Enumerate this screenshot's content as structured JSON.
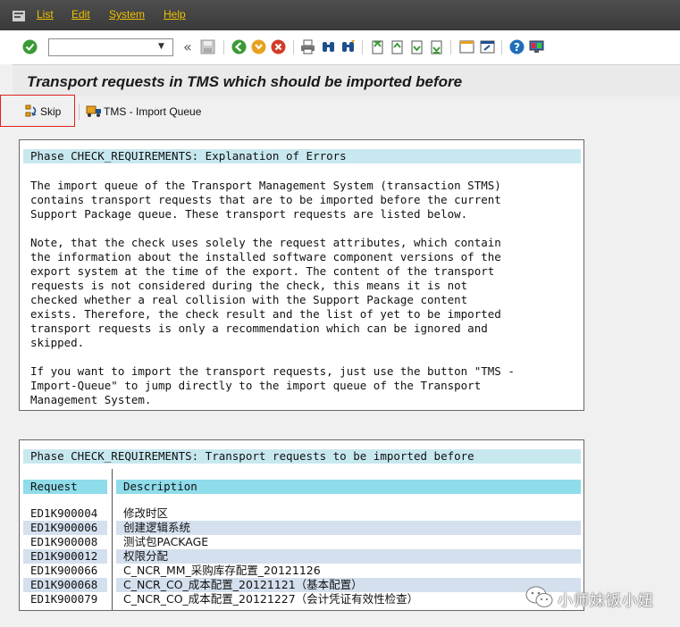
{
  "menubar": {
    "items": [
      {
        "label": "List"
      },
      {
        "label": "Edit"
      },
      {
        "label": "System"
      },
      {
        "label": "Help"
      }
    ]
  },
  "toolbar": {
    "command_field_value": "",
    "icons": [
      "enter-icon",
      "back-icon",
      "save-icon",
      "back-green-icon",
      "exit-icon",
      "cancel-icon",
      "print-icon",
      "find-icon",
      "find-next-icon",
      "first-page-icon",
      "prev-page-icon",
      "next-page-icon",
      "last-page-icon",
      "create-session-icon",
      "shortcut-icon",
      "help-icon",
      "customize-layout-icon"
    ]
  },
  "title": "Transport requests in TMS which should be imported before",
  "app_toolbar": {
    "skip_label": "Skip",
    "tms_label": "TMS - Import Queue"
  },
  "panel1": {
    "heading": "Phase CHECK_REQUIREMENTS: Explanation of Errors",
    "body": "The import queue of the Transport Management System (transaction STMS)\ncontains transport requests that are to be imported before the current\nSupport Package queue. These transport requests are listed below.\n\nNote, that the check uses solely the request attributes, which contain\nthe information about the installed software component versions of the\nexport system at the time of the export. The content of the transport\nrequests is not considered during the check, this means it is not\nchecked whether a real collision with the Support Package content\nexists. Therefore, the check result and the list of yet to be imported\ntransport requests is only a recommendation which can be ignored and\nskipped.\n\nIf you want to import the transport requests, just use the button \"TMS -\nImport-Queue\" to jump directly to the import queue of the Transport\nManagement System."
  },
  "panel2": {
    "heading": "Phase CHECK_REQUIREMENTS: Transport requests to be imported before",
    "columns": {
      "request": "Request",
      "description": "Description"
    },
    "rows": [
      {
        "request": "ED1K900004",
        "description": "修改时区"
      },
      {
        "request": "ED1K900006",
        "description": "创建逻辑系统"
      },
      {
        "request": "ED1K900008",
        "description": "测试包PACKAGE"
      },
      {
        "request": "ED1K900012",
        "description": "权限分配"
      },
      {
        "request": "ED1K900066",
        "description": "C_NCR_MM_采购库存配置_20121126"
      },
      {
        "request": "ED1K900068",
        "description": "C_NCR_CO_成本配置_20121121（基本配置）"
      },
      {
        "request": "ED1K900079",
        "description": "C_NCR_CO_成本配置_20121227（会计凭证有效性检查）"
      }
    ]
  },
  "watermark": {
    "text": "小师妹饭小妞"
  },
  "colors": {
    "menubar": "#3a3a3a",
    "menu_text": "#f2c100",
    "phase_bg": "#c8e8f0",
    "column_header_bg": "#8fdcea",
    "alt_row_bg": "#d4e0ee",
    "highlight_border": "#e02020"
  }
}
